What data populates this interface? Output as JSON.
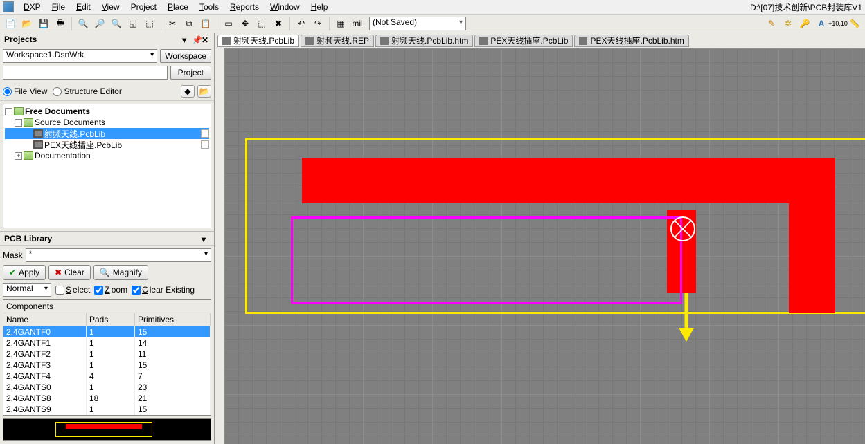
{
  "menu": {
    "dxp": "DXP",
    "file": "File",
    "edit": "Edit",
    "view": "View",
    "project": "Project",
    "place": "Place",
    "tools": "Tools",
    "reports": "Reports",
    "window": "Window",
    "help": "Help"
  },
  "titlepath": "D:\\[07]技术创新\\PCB封装库V1",
  "toolbar": {
    "notsaved": "(Not Saved)"
  },
  "projects": {
    "title": "Projects",
    "workspace": "Workspace1.DsnWrk",
    "workspace_btn": "Workspace",
    "project_btn": "Project",
    "fileview": "File View",
    "structure": "Structure Editor",
    "tree": {
      "root": "Free Documents",
      "src": "Source Documents",
      "f1": "射频天线.PcbLib",
      "f2": "PEX天线插座.PcbLib",
      "doc": "Documentation"
    }
  },
  "lib": {
    "title": "PCB Library",
    "mask": "Mask",
    "mask_val": "*",
    "apply": "Apply",
    "clear": "Clear",
    "magnify": "Magnify",
    "mode": "Normal",
    "select": "Select",
    "zoom": "Zoom",
    "clearex": "Clear Existing",
    "components": "Components",
    "cols": {
      "name": "Name",
      "pads": "Pads",
      "prims": "Primitives"
    },
    "rows": [
      {
        "n": "2.4GANTF0",
        "p": "1",
        "r": "15"
      },
      {
        "n": "2.4GANTF1",
        "p": "1",
        "r": "14"
      },
      {
        "n": "2.4GANTF2",
        "p": "1",
        "r": "11"
      },
      {
        "n": "2.4GANTF3",
        "p": "1",
        "r": "15"
      },
      {
        "n": "2.4GANTF4",
        "p": "4",
        "r": "7"
      },
      {
        "n": "2.4GANTS0",
        "p": "1",
        "r": "23"
      },
      {
        "n": "2.4GANTS8",
        "p": "18",
        "r": "21"
      },
      {
        "n": "2.4GANTS9",
        "p": "1",
        "r": "15"
      }
    ]
  },
  "tabs": [
    {
      "l": "射频天线.PcbLib",
      "ic": "pcb"
    },
    {
      "l": "射频天线.REP",
      "ic": "txt"
    },
    {
      "l": "射频天线.PcbLib.htm",
      "ic": "htm"
    },
    {
      "l": "PEX天线插座.PcbLib",
      "ic": "pcb"
    },
    {
      "l": "PEX天线插座.PcbLib.htm",
      "ic": "htm"
    }
  ]
}
